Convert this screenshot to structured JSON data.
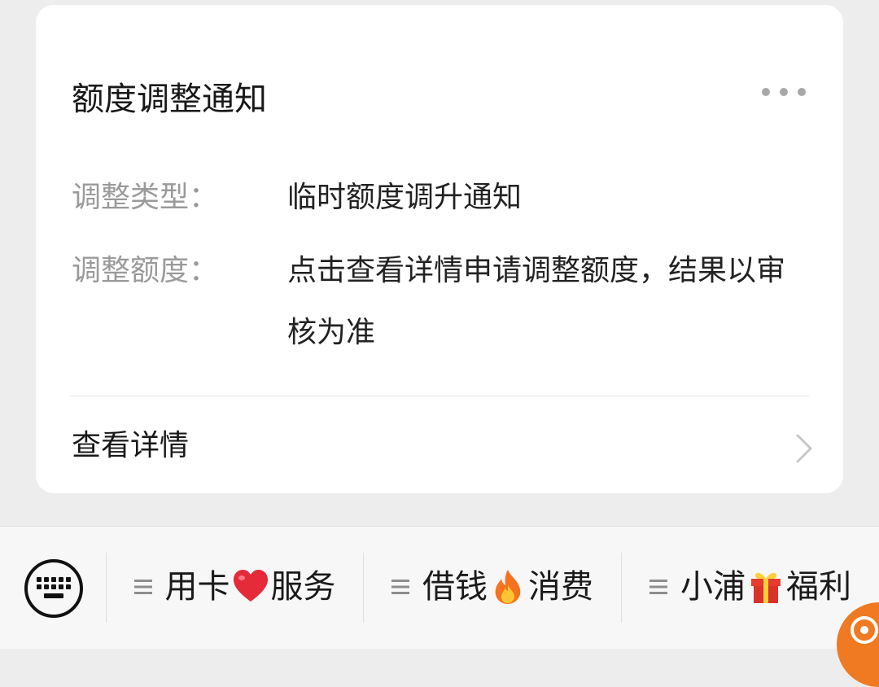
{
  "card": {
    "title": "额度调整通知",
    "rows": [
      {
        "label": "调整类型：",
        "value": "临时额度调升通知"
      },
      {
        "label": "调整额度：",
        "value": "点击查看详情申请调整额度，结果以审核为准"
      }
    ],
    "detail_label": "查看详情"
  },
  "bottom_menu": {
    "items": [
      {
        "text_before": "用卡",
        "emoji": "heart-icon",
        "text_after": "服务"
      },
      {
        "text_before": "借钱",
        "emoji": "fire-icon",
        "text_after": "消费"
      },
      {
        "text_before": "小浦",
        "emoji": "gift-icon",
        "text_after": "福利"
      }
    ]
  },
  "colors": {
    "background": "#ededed",
    "card": "#ffffff",
    "label_gray": "#9a9a9a",
    "text_dark": "#181818",
    "accent_orange": "#f07a22",
    "heart_red": "#e52b3a"
  }
}
